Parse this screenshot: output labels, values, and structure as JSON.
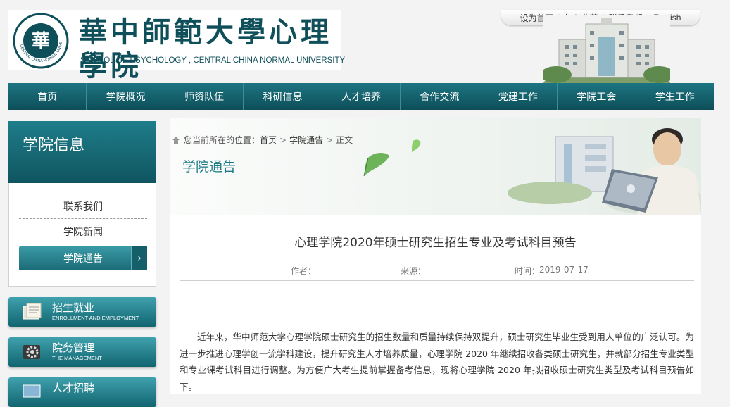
{
  "header": {
    "logo_cn": "華中師範大學心理學院",
    "logo_en": "SCHOOL OF PSYCHOLOGY , CENTRAL CHINA NORMAL UNIVERSITY",
    "seal_text": "CENTRAL CHINA NORMAL UNIVERSITY",
    "top_links": [
      "设为首页",
      "加入收藏",
      "联系我们",
      "English"
    ]
  },
  "nav": {
    "items": [
      "首页",
      "学院概况",
      "师资队伍",
      "科研信息",
      "人才培养",
      "合作交流",
      "党建工作",
      "学院工会",
      "学生工作"
    ]
  },
  "sidebar": {
    "title": "学院信息",
    "links": [
      "联系我们",
      "学院新闻",
      "学院通告"
    ],
    "active_index": 2,
    "chevron": "›",
    "banners": [
      {
        "cn": "招生就业",
        "en": "ENROLLMENT AND EMPLOYMENT",
        "icon": "folder-icon"
      },
      {
        "cn": "院务管理",
        "en": "THE MANAGEMENT",
        "icon": "gear-icon"
      },
      {
        "cn": "人才招聘",
        "en": "",
        "icon": "monitor-icon"
      }
    ]
  },
  "main": {
    "breadcrumb": {
      "prefix": "您当前所在的位置：",
      "items": [
        "首页",
        "学院通告",
        "正文"
      ],
      "separator": ">"
    },
    "banner_title": "学院通告",
    "article": {
      "title": "心理学院2020年硕士研究生招生专业及考试科目预告",
      "author_label": "作者：",
      "author": "",
      "source_label": "来源：",
      "source": "",
      "time_label": "时间：",
      "time": "2019-07-17",
      "body": "近年来，华中师范大学心理学院硕士研究生的招生数量和质量持续保持双提升，硕士研究生毕业生受到用人单位的广泛认可。为进一步推进心理学创一流学科建设，提升研究生人才培养质量，心理学院 2020 年继续招收各类硕士研究生，并就部分招生专业类型和专业课考试科目进行调整。为方便广大考生提前掌握备考信息，现将心理学院 2020 年拟招收硕士研究生类型及考试科目预告如下。"
    }
  },
  "colors": {
    "brand_teal": "#0f4f5a",
    "nav_teal": "#1d7582",
    "accent_teal": "#1b7a86"
  }
}
